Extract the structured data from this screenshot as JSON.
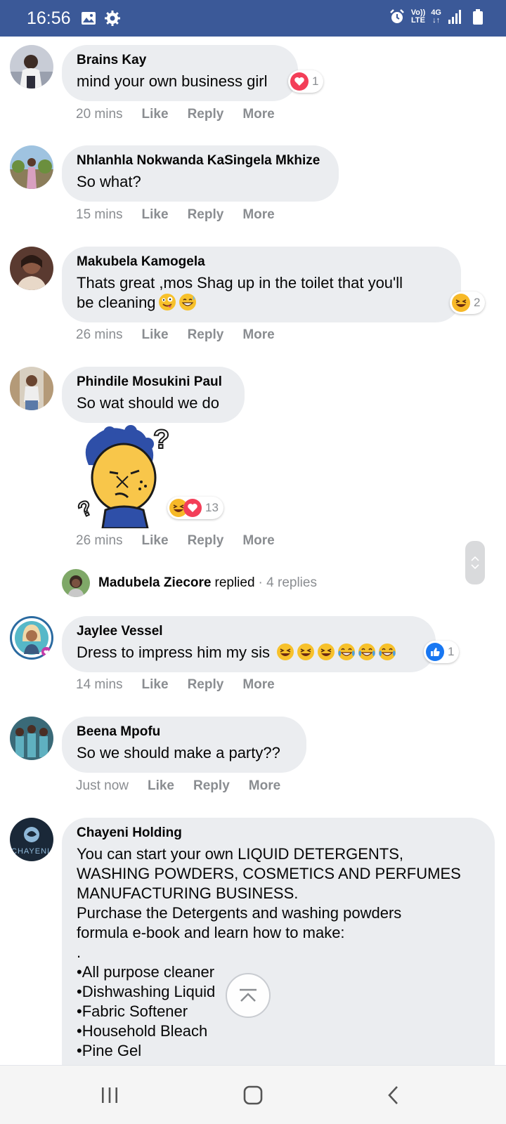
{
  "status_bar": {
    "time": "16:56",
    "left_icons": [
      "gallery-icon",
      "settings-gear-icon"
    ],
    "right_icons": [
      "alarm-icon",
      "volte-icon",
      "4g-icon",
      "signal-icon",
      "battery-icon"
    ],
    "volte_label_top": "Vo))",
    "volte_label_bottom": "LTE",
    "net_label": "4G",
    "bg_color": "#3b5998"
  },
  "comments": [
    {
      "author": "Brains Kay",
      "text": "mind your own business girl",
      "time": "20 mins",
      "like": "Like",
      "reply": "Reply",
      "more": "More",
      "reactions": {
        "icons": [
          "love-reaction-icon"
        ],
        "count": "1"
      }
    },
    {
      "author": "Nhlanhla Nokwanda KaSingela Mkhize",
      "text": "So what?",
      "time": "15 mins",
      "like": "Like",
      "reply": "Reply",
      "more": "More"
    },
    {
      "author": "Makubela Kamogela",
      "text": "Thats great ,mos Shag up in the toilet that you'll\nbe cleaning",
      "emojis": [
        "zany-face-emoji",
        "grinning-sweat-emoji"
      ],
      "time": "26 mins",
      "like": "Like",
      "reply": "Reply",
      "more": "More",
      "reactions": {
        "icons": [
          "haha-reaction-icon"
        ],
        "count": "2"
      }
    },
    {
      "author": "Phindile Mosukini Paul",
      "text": "So wat should we do",
      "sticker": "thinking-character-sticker",
      "time": "26 mins",
      "like": "Like",
      "reply": "Reply",
      "more": "More",
      "reactions": {
        "icons": [
          "haha-reaction-icon",
          "love-reaction-icon"
        ],
        "count": "13"
      },
      "replies": {
        "name": "Madubela Ziecore",
        "verb": "replied",
        "count": "· 4 replies"
      }
    },
    {
      "author": "Jaylee Vessel",
      "text": "Dress to impress him my sis",
      "emojis": [
        "laughing-emoji",
        "laughing-emoji",
        "laughing-emoji",
        "tears-of-joy-emoji",
        "tears-of-joy-emoji",
        "tears-of-joy-emoji"
      ],
      "time": "14 mins",
      "like": "Like",
      "reply": "Reply",
      "more": "More",
      "reactions": {
        "icons": [
          "like-reaction-icon"
        ],
        "count": "1"
      }
    },
    {
      "author": "Beena Mpofu",
      "text": "So we should make a party??",
      "time": "Just now",
      "like": "Like",
      "reply": "Reply",
      "more": "More"
    },
    {
      "author": "Chayeni Holding",
      "text": "You can start your own LIQUID DETERGENTS,\nWASHING POWDERS, COSMETICS AND PERFUMES\nMANUFACTURING BUSINESS.\nPurchase the Detergents and washing powders\nformula e-book and learn how to make:\n.\n•All purpose cleaner\n•Dishwashing Liquid\n•Fabric Softener\n•Household Bleach\n•Pine Gel"
    }
  ],
  "colors": {
    "bubble": "#ebedf0",
    "meta_text": "#8a8d91",
    "love": "#f33e58",
    "like": "#1877f2",
    "haha": "#f7b928"
  }
}
